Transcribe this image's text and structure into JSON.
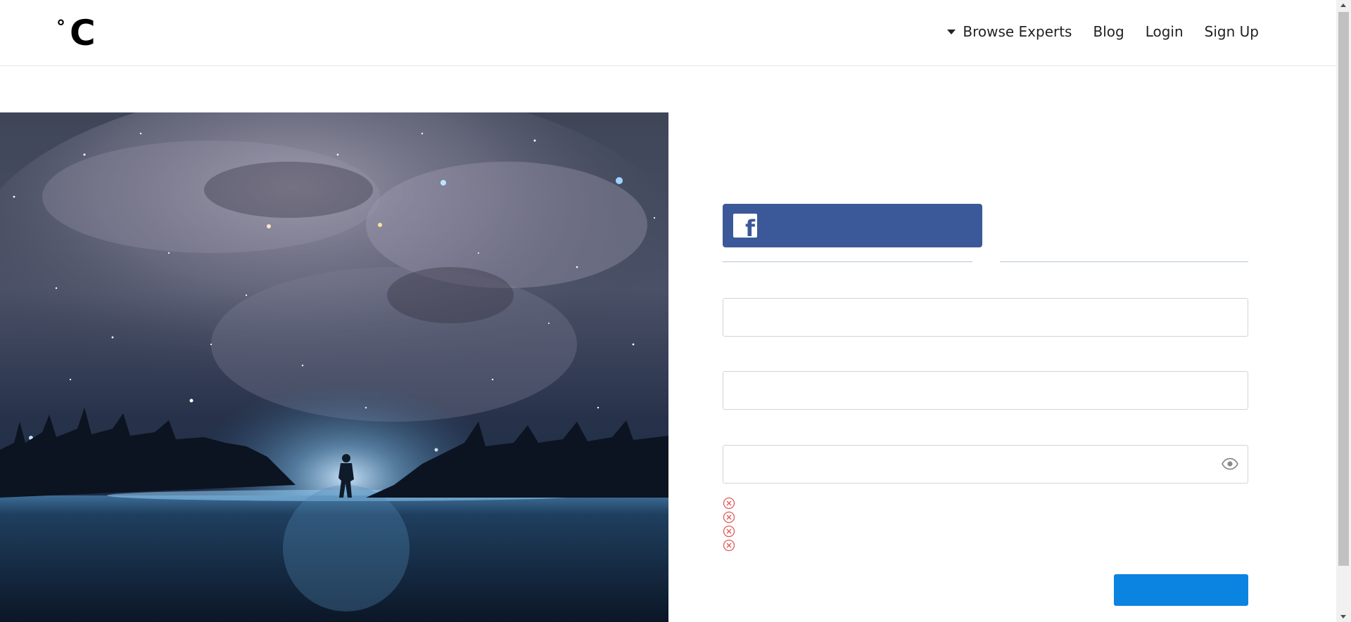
{
  "header": {
    "logo": {
      "degree": "°",
      "letter": "C"
    },
    "nav": {
      "browse_experts": "Browse Experts",
      "blog": "Blog",
      "login": "Login",
      "signup": "Sign Up"
    }
  },
  "hero": {
    "icon": "starry-sky-silhouette-image"
  },
  "form": {
    "facebook_button": {
      "label": "",
      "icon": "facebook-icon",
      "color": "#3b5998"
    },
    "fields": [
      {
        "value": "",
        "placeholder": ""
      },
      {
        "value": "",
        "placeholder": ""
      },
      {
        "value": "",
        "placeholder": "",
        "icon": "eye-icon"
      }
    ],
    "password_rules": [
      {
        "icon": "x-circle-icon",
        "text": ""
      },
      {
        "icon": "x-circle-icon",
        "text": ""
      },
      {
        "icon": "x-circle-icon",
        "text": ""
      },
      {
        "icon": "x-circle-icon",
        "text": ""
      }
    ],
    "submit": {
      "label": "",
      "color": "#0a84e0"
    }
  },
  "colors": {
    "rule_invalid": "#e05a5a",
    "divider": "#b7c3d6"
  }
}
